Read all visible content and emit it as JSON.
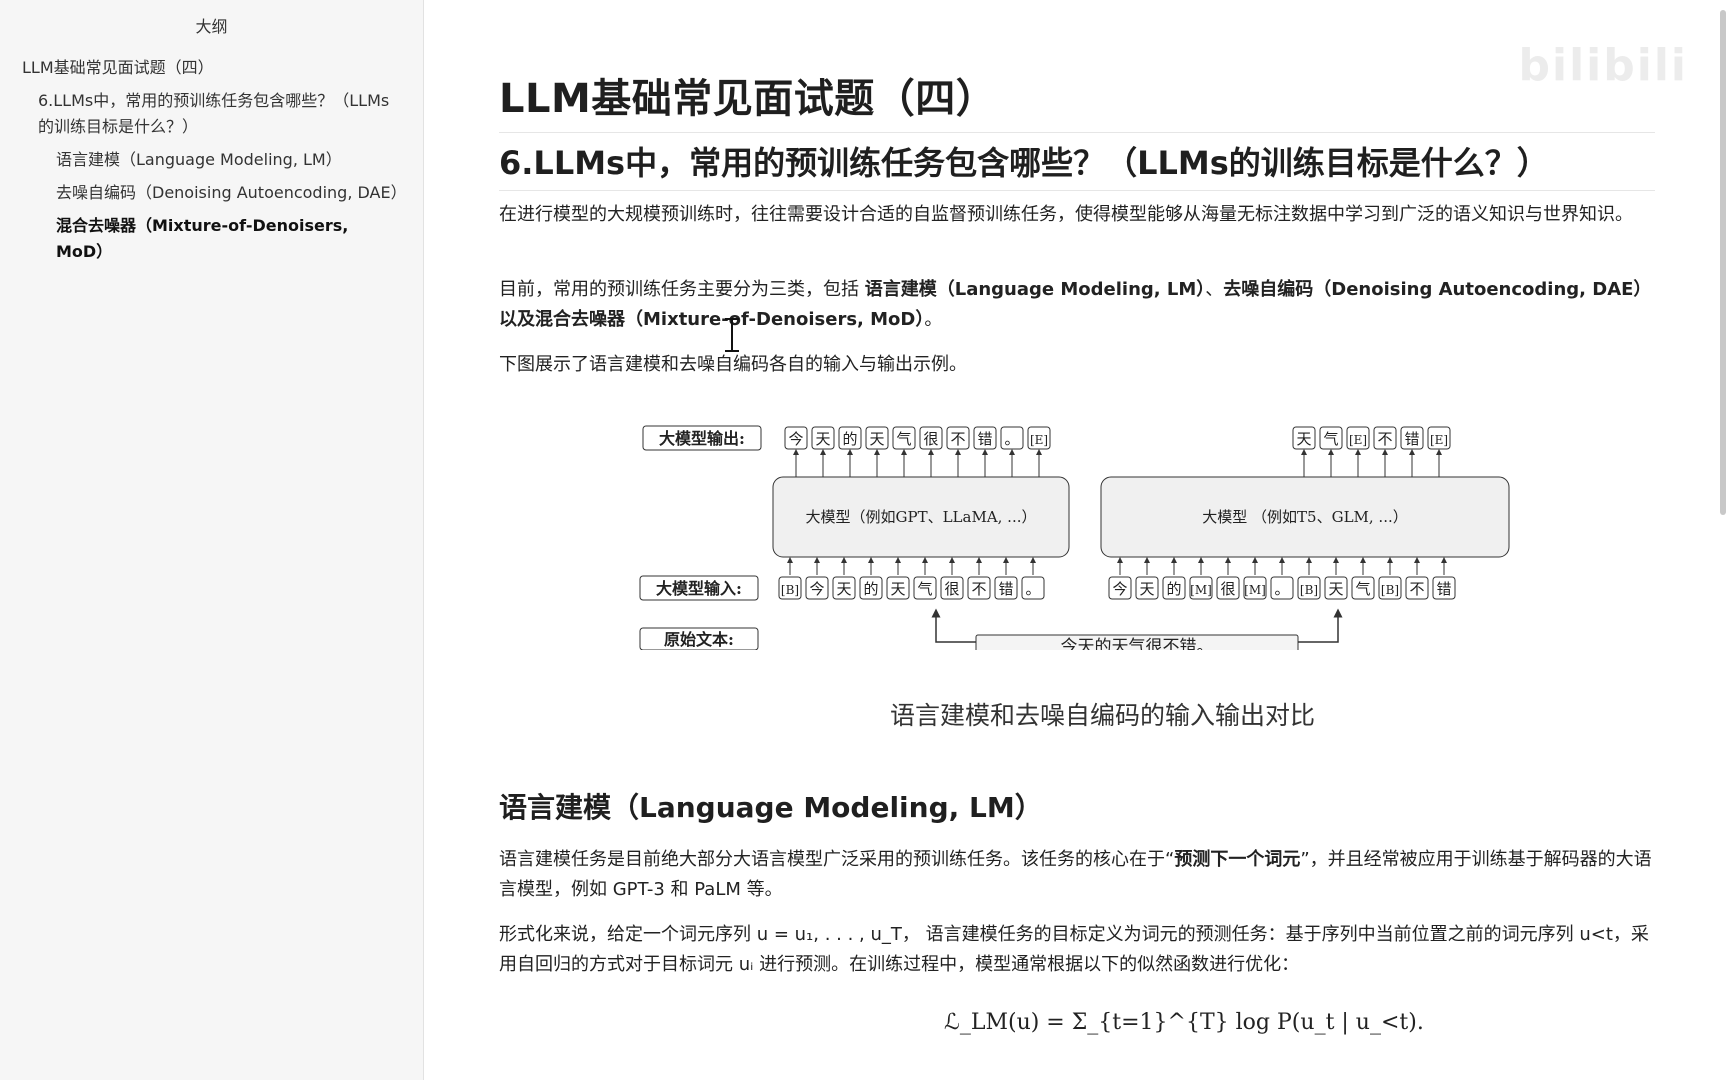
{
  "sidebar": {
    "outline_title": "大纲",
    "items": [
      {
        "label": "LLM基础常见面试题（四）"
      },
      {
        "label": "6.LLMs中，常用的预训练任务包含哪些？（LLMs的训练目标是什么？）"
      },
      {
        "label": "语言建模（Language Modeling, LM）"
      },
      {
        "label": "去噪自编码（Denoising Autoencoding, DAE）"
      },
      {
        "label": "混合去噪器（Mixture-of-Denoisers, MoD）"
      }
    ]
  },
  "content": {
    "title": "LLM基础常见面试题（四）",
    "section_title": "6.LLMs中，常用的预训练任务包含哪些？（LLMs的训练目标是什么？）",
    "para1": "在进行模型的大规模预训练时，往往需要设计合适的自监督预训练任务，使得模型能够从海量无标注数据中学习到广泛的语义知识与世界知识。",
    "para2_prefix": "目前，常用的预训练任务主要分为三类，包括 ",
    "para2_bold1": "语言建模（Language Modeling, LM）",
    "para2_sep": "、",
    "para2_bold2": "去噪自编码（Denoising Autoencoding, DAE）",
    "para2_mid": "以及",
    "para2_bold3": "混合去噪器（Mixture-of-Denoisers, MoD）",
    "para2_suffix": "。",
    "para3": "下图展示了语言建模和去噪自编码各自的输入与输出示例。",
    "figure": {
      "label_output": "大模型输出:",
      "label_input": "大模型输入:",
      "label_raw": "原始文本:",
      "left_model": "大模型（例如GPT、LLaMA, ...）",
      "right_model": "大模型 （例如T5、GLM, ...）",
      "raw_text": "今天的天气很不错。",
      "left_outputs": [
        "今",
        "天",
        "的",
        "天",
        "气",
        "很",
        "不",
        "错",
        "。",
        "[E]"
      ],
      "left_inputs": [
        "[B]",
        "今",
        "天",
        "的",
        "天",
        "气",
        "很",
        "不",
        "错",
        "。"
      ],
      "right_outputs": [
        "天",
        "气",
        "[E]",
        "不",
        "错",
        "[E]"
      ],
      "right_inputs": [
        "今",
        "天",
        "的",
        "[M]",
        "很",
        "[M]",
        "。",
        "[B]",
        "天",
        "气",
        "[B]",
        "不",
        "错"
      ],
      "caption": "语言建模和去噪自编码的输入输出对比"
    },
    "sub_title": "语言建模（Language Modeling, LM）",
    "para4_prefix": "语言建模任务是目前绝大部分大语言模型广泛采用的预训练任务。该任务的核心在于“",
    "para4_bold": "预测下一个词元",
    "para4_suffix": "”，并且经常被应用于训练基于解码器的大语言模型，例如 GPT-3 和 PaLM 等。",
    "para5": "形式化来说，给定一个词元序列 u = u₁, . . . , u_T， 语言建模任务的目标定义为词元的预测任务：基于序列中当前位置之前的词元序列 u<t，采用自回归的方式对于目标词元 uᵢ 进行预测。在训练过程中，模型通常根据以下的似然函数进行优化：",
    "formula": "ℒ_LM(u) = Σ_{t=1}^{T} log P(u_t | u_<t)."
  },
  "watermark": "bilibili"
}
